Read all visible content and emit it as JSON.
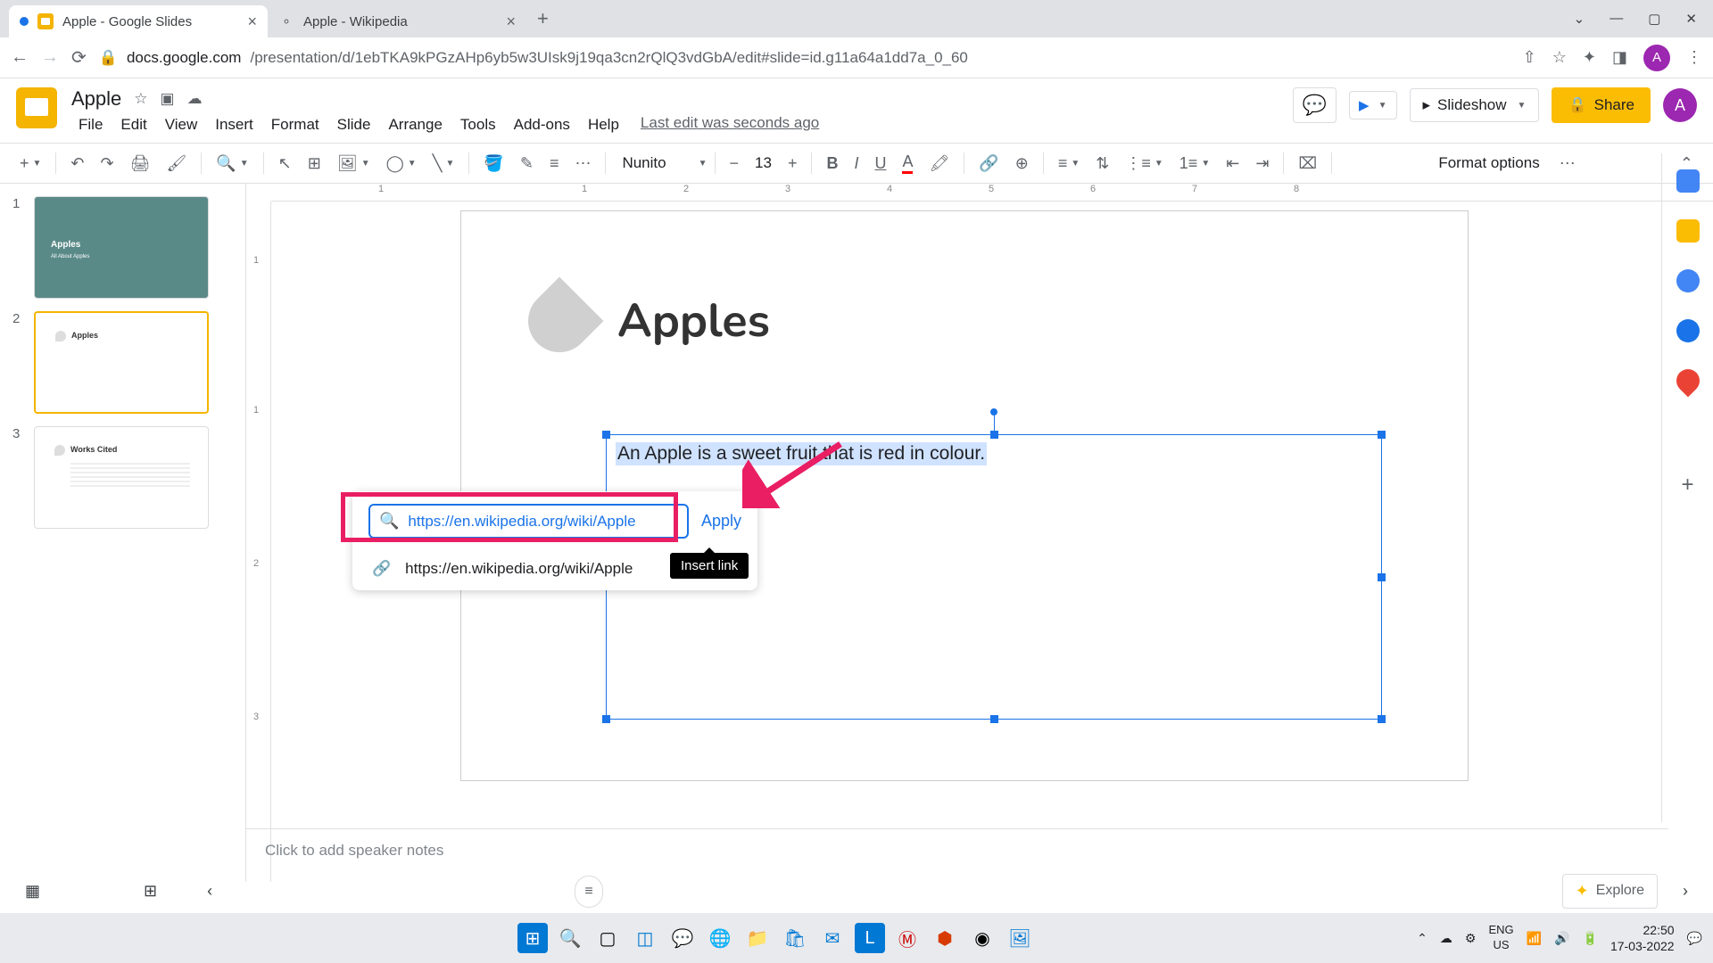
{
  "browser": {
    "tabs": [
      {
        "title": "Apple - Google Slides",
        "active": true
      },
      {
        "title": "Apple - Wikipedia",
        "active": false
      }
    ],
    "url_host": "docs.google.com",
    "url_path": "/presentation/d/1ebTKA9kPGzAHp6yb5w3UIsk9j19qa3cn2rQlQ3vdGbA/edit#slide=id.g11a64a1dd7a_0_60"
  },
  "doc": {
    "title": "Apple",
    "menus": [
      "File",
      "Edit",
      "View",
      "Insert",
      "Format",
      "Slide",
      "Arrange",
      "Tools",
      "Add-ons",
      "Help"
    ],
    "last_edit": "Last edit was seconds ago",
    "slideshow_label": "Slideshow",
    "share_label": "Share"
  },
  "toolbar": {
    "font_name": "Nunito",
    "font_size": "13",
    "format_options": "Format options"
  },
  "slides": {
    "thumbs": [
      {
        "num": "1",
        "title": "Apples",
        "sub": "All About Apples"
      },
      {
        "num": "2",
        "title": "Apples"
      },
      {
        "num": "3",
        "title": "Works Cited"
      }
    ],
    "canvas_title": "Apples",
    "selected_text": "An Apple is a sweet fruit that is red in colour."
  },
  "link_dialog": {
    "input_value": "https://en.wikipedia.org/wiki/Apple",
    "apply_label": "Apply",
    "suggestion": "https://en.wikipedia.org/wiki/Apple",
    "tooltip": "Insert link"
  },
  "ruler": {
    "marks": [
      "1",
      "1",
      "2",
      "3",
      "4",
      "5",
      "6",
      "7",
      "8"
    ],
    "vmarks": [
      "1",
      "1",
      "2",
      "3"
    ]
  },
  "speaker_notes_placeholder": "Click to add speaker notes",
  "explore_label": "Explore",
  "system": {
    "lang1": "ENG",
    "lang2": "US",
    "time": "22:50",
    "date": "17-03-2022"
  },
  "avatar_letter": "A"
}
